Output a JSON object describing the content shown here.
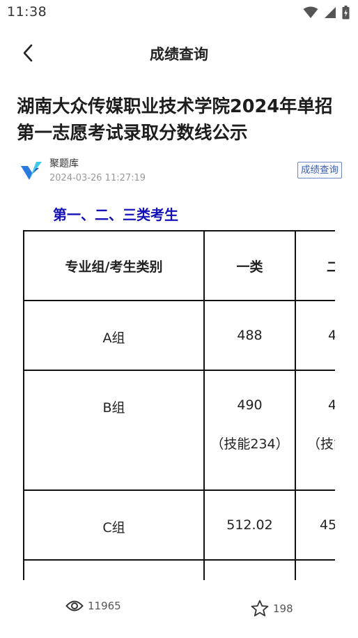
{
  "status": {
    "time": "11:38"
  },
  "nav": {
    "title": "成绩查询"
  },
  "article": {
    "title": "湖南大众传媒职业技术学院2024年单招第一志愿考试录取分数线公示",
    "source": "聚题库",
    "time": "2024-03-26 11:27:19",
    "tag": "成绩查询",
    "section_heading": "第一、二、三类考生"
  },
  "table": {
    "headers": [
      "专业组/考生类别",
      "一类",
      "二"
    ],
    "rows": [
      {
        "group": "A组",
        "c1": "488",
        "c1_note": "",
        "c2": "4",
        "c2_note": ""
      },
      {
        "group": "B组",
        "c1": "490",
        "c1_note": "（技能234）",
        "c2": "4",
        "c2_note": "（技能"
      },
      {
        "group": "C组",
        "c1": "512.02",
        "c1_note": "",
        "c2": "45",
        "c2_note": ""
      }
    ]
  },
  "bottom": {
    "views": "11965",
    "favorites": "198"
  },
  "colors": {
    "section_heading": "#1511b8",
    "tag_border": "#6e88c6",
    "logo_blue": "#2a7be0",
    "logo_cyan": "#3fc8e6"
  }
}
